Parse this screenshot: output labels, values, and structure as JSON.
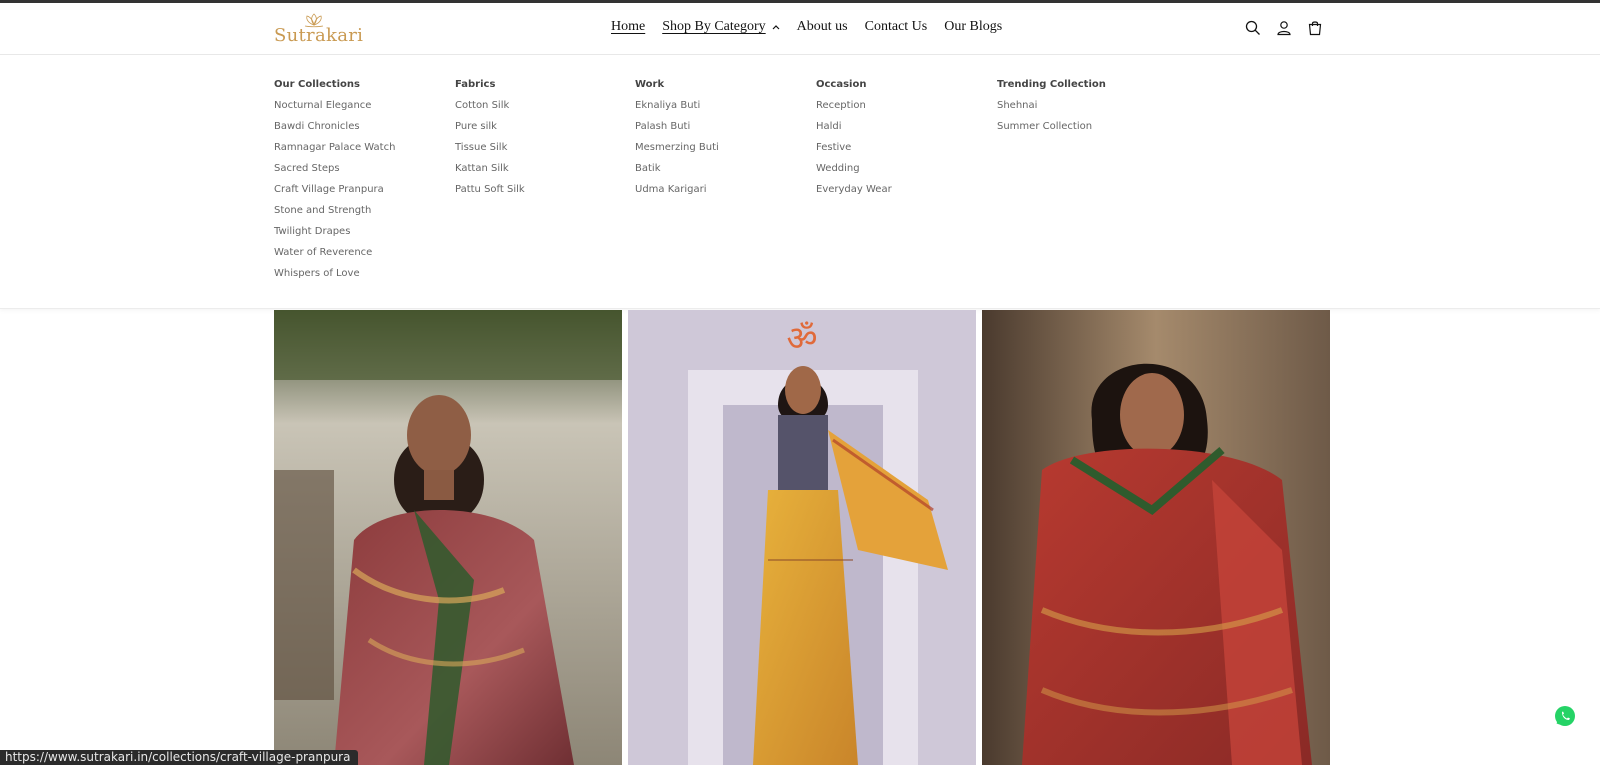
{
  "brand": {
    "name": "Sutrakari",
    "color": "#c99a52"
  },
  "nav": {
    "home": "Home",
    "shop_by_category": "Shop By Category",
    "about": "About us",
    "contact": "Contact Us",
    "blogs": "Our Blogs"
  },
  "header_icons": [
    "search-icon",
    "account-icon",
    "cart-icon"
  ],
  "mega_menu": {
    "columns": [
      {
        "heading": "Our Collections",
        "items": [
          "Nocturnal Elegance",
          "Bawdi Chronicles",
          "Ramnagar Palace Watch",
          "Sacred Steps",
          "Craft Village Pranpura",
          "Stone and Strength",
          "Twilight Drapes",
          "Water of Reverence",
          "Whispers of Love"
        ]
      },
      {
        "heading": "Fabrics",
        "items": [
          "Cotton Silk",
          "Pure silk",
          "Tissue Silk",
          "Kattan Silk",
          "Pattu Soft Silk"
        ]
      },
      {
        "heading": "Work",
        "items": [
          "Eknaliya Buti",
          "Palash Buti",
          "Mesmerzing Buti",
          "Batik",
          "Udma Karigari"
        ]
      },
      {
        "heading": "Occasion",
        "items": [
          "Reception",
          "Haldi",
          "Festive",
          "Wedding",
          "Everyday Wear"
        ]
      },
      {
        "heading": "Trending Collection",
        "items": [
          "Shehnai",
          "Summer Collection"
        ]
      }
    ]
  },
  "status_url": "https://www.sutrakari.in/collections/craft-village-pranpura",
  "colors": {
    "whatsapp": "#25d366",
    "status_bg": "#2b2b2b"
  }
}
